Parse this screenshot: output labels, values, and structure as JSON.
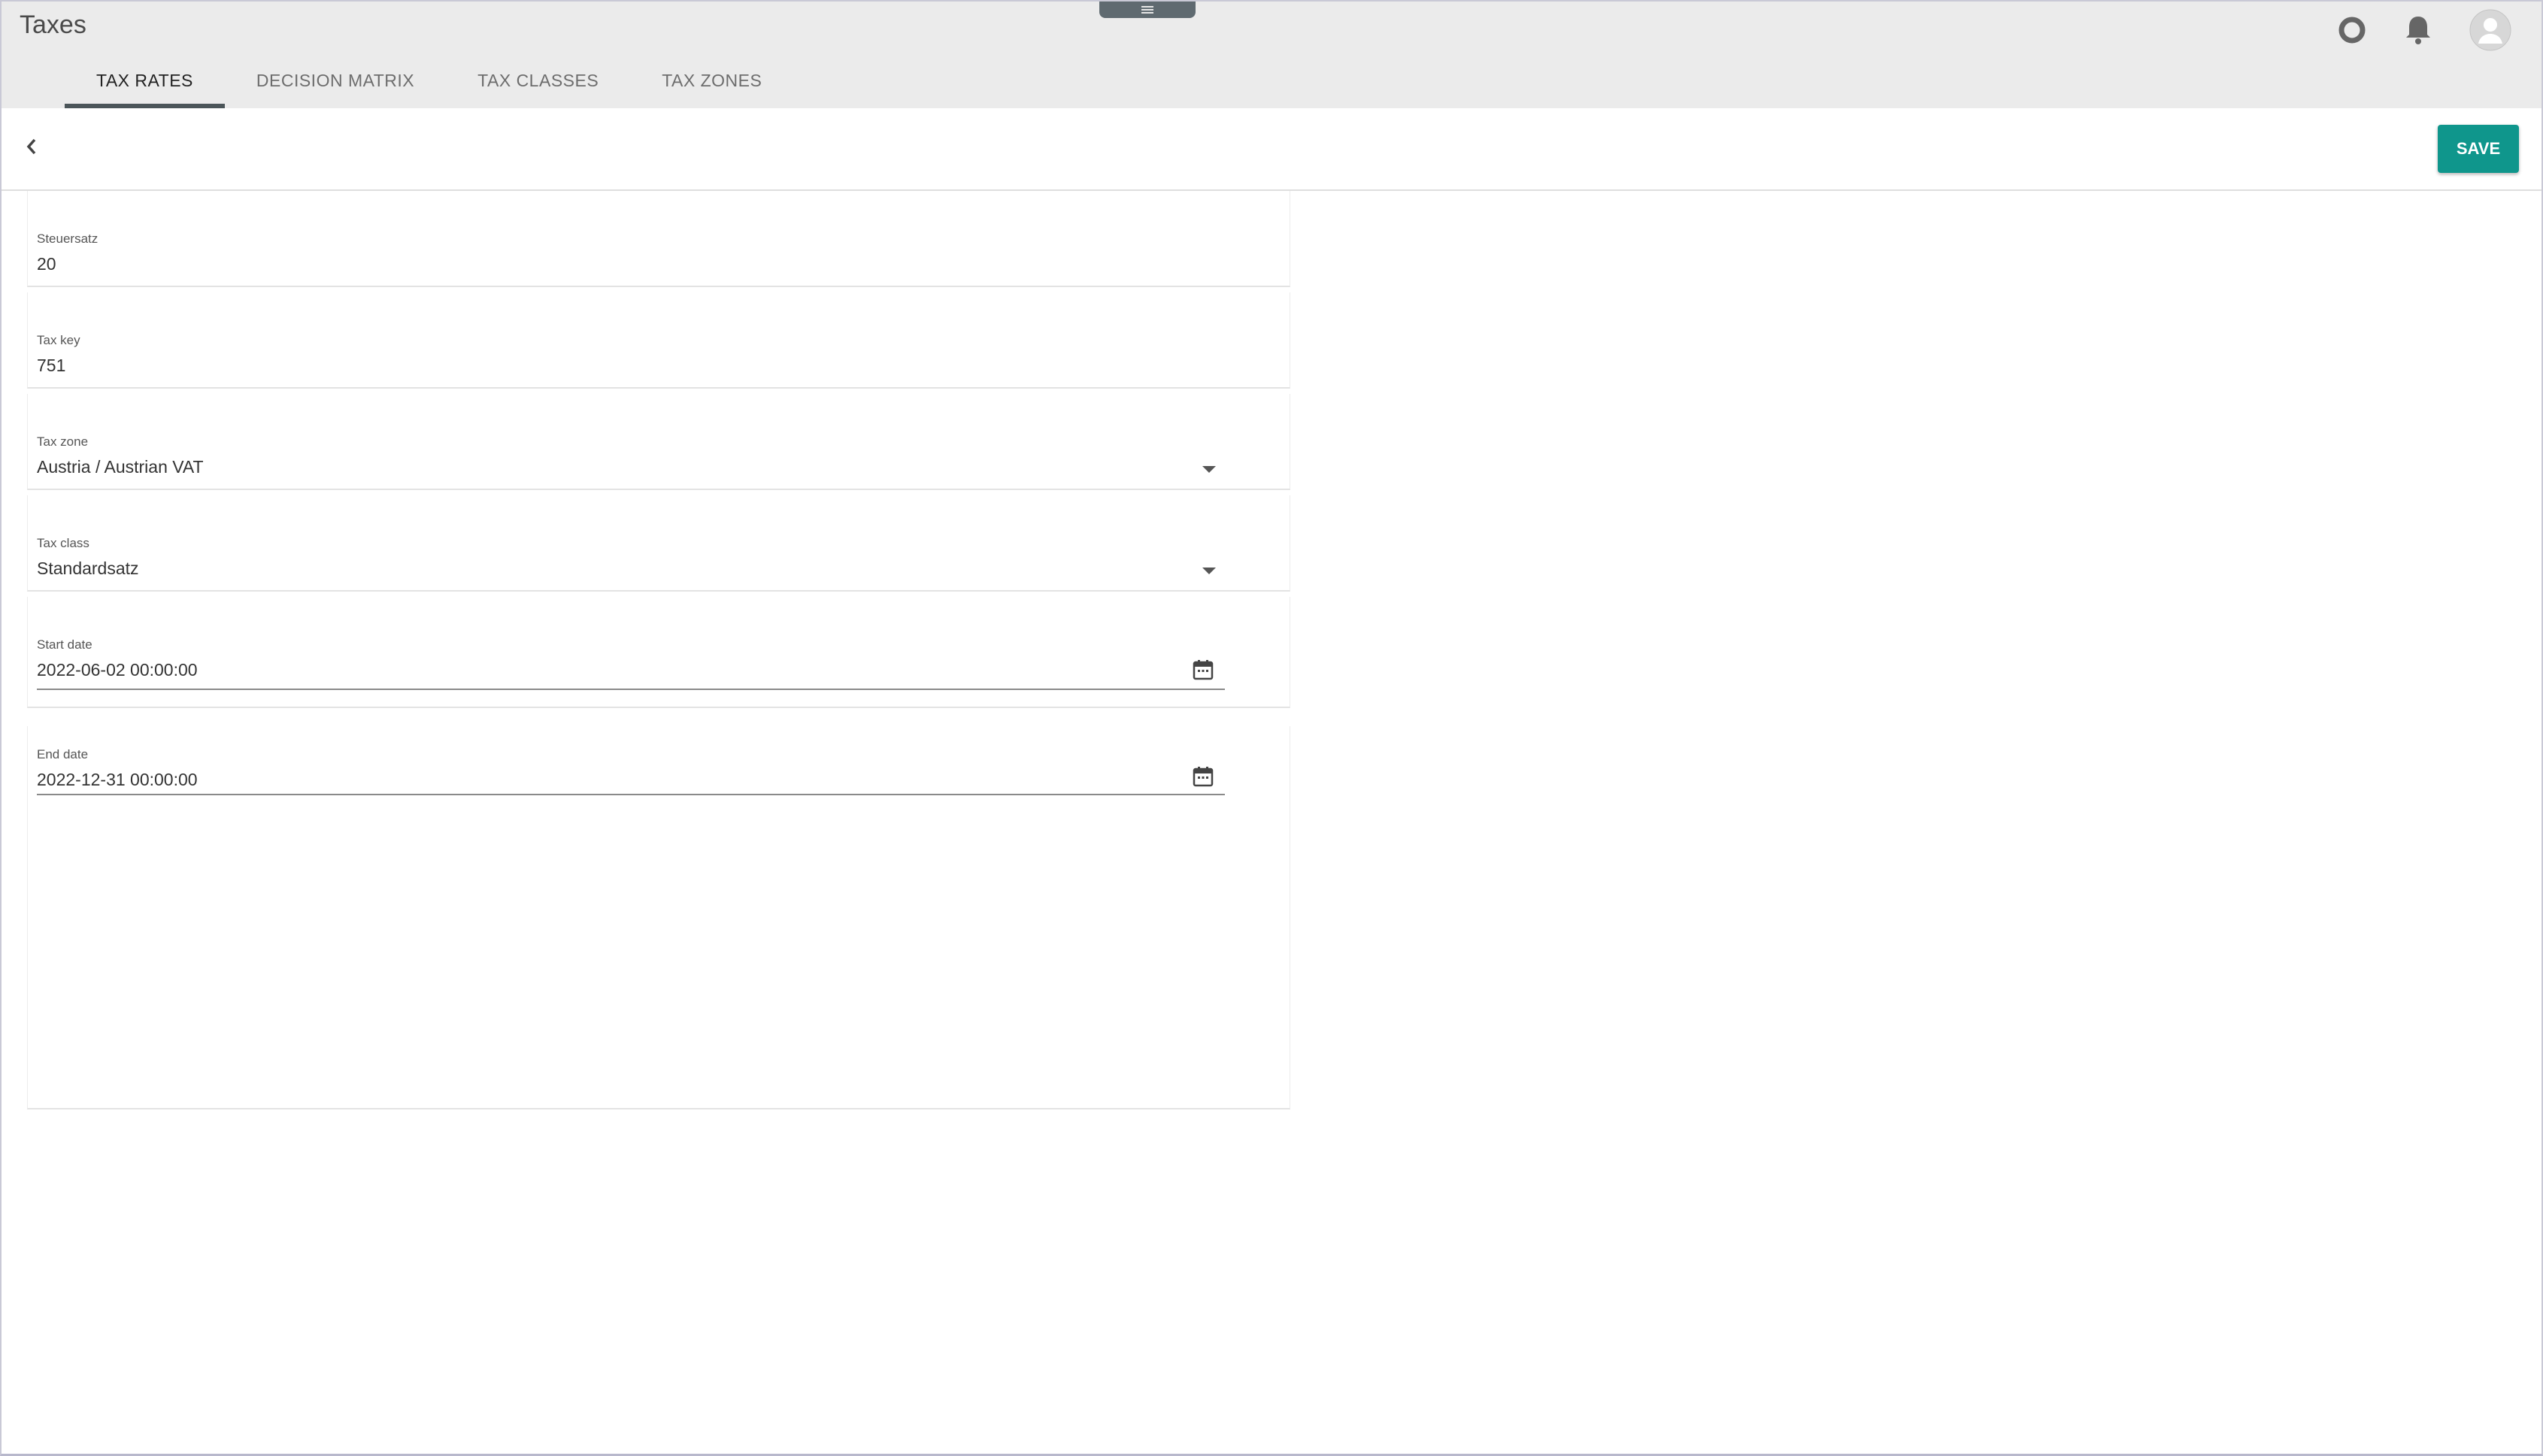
{
  "app": {
    "title": "Taxes"
  },
  "tabs": [
    {
      "label": "TAX RATES",
      "active": true
    },
    {
      "label": "DECISION MATRIX",
      "active": false
    },
    {
      "label": "TAX CLASSES",
      "active": false
    },
    {
      "label": "TAX ZONES",
      "active": false
    }
  ],
  "toolbar": {
    "save_label": "SAVE"
  },
  "form": {
    "tax_rate": {
      "label": "Steuersatz",
      "value": "20"
    },
    "tax_key": {
      "label": "Tax key",
      "value": "751"
    },
    "tax_zone": {
      "label": "Tax zone",
      "value": "Austria / Austrian VAT"
    },
    "tax_class": {
      "label": "Tax class",
      "value": "Standardsatz"
    },
    "start_date": {
      "label": "Start date",
      "value": "2022-06-02 00:00:00"
    },
    "end_date": {
      "label": "End date",
      "value": "2022-12-31 00:00:00"
    }
  },
  "colors": {
    "accent": "#0f968c",
    "header_bg": "#ebebeb",
    "tab_indicator": "#4b5559"
  },
  "icons": [
    "menu-handle-icon",
    "help-circle-icon",
    "bell-icon",
    "user-avatar-icon",
    "chevron-left-icon",
    "chevron-down-icon",
    "calendar-icon"
  ]
}
